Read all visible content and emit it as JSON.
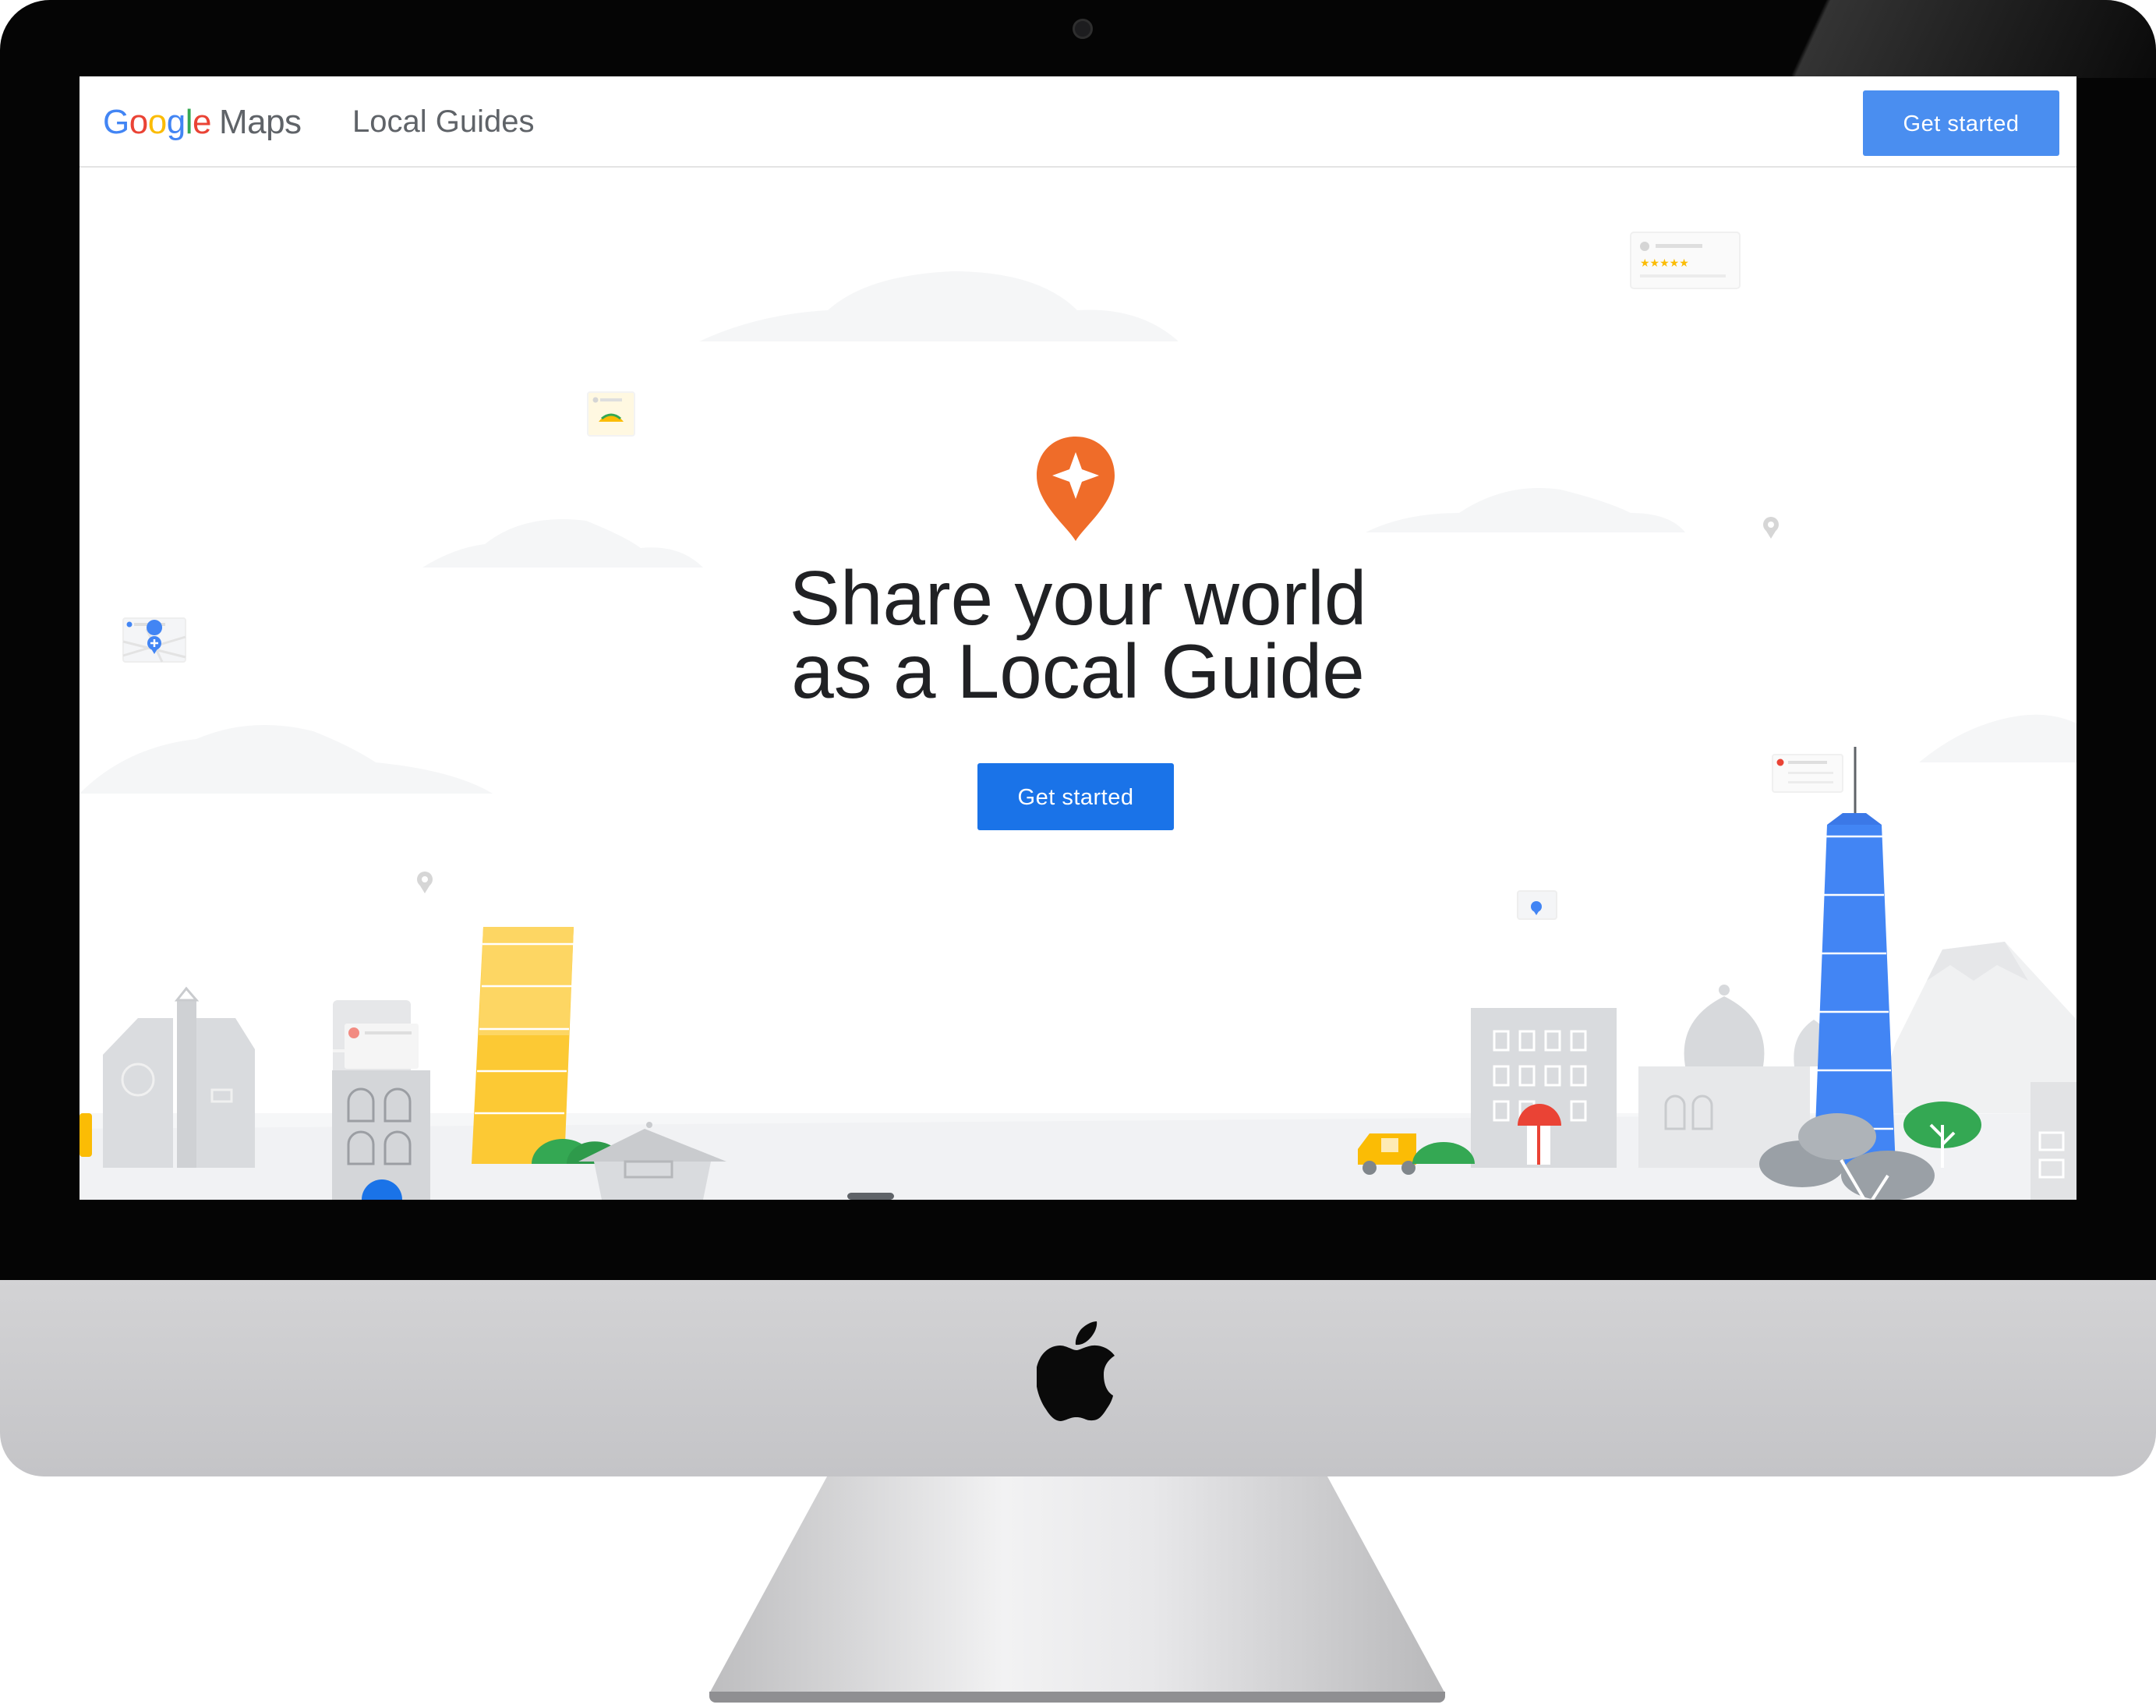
{
  "header": {
    "logo_google": "Google",
    "logo_maps": "Maps",
    "nav_title": "Local Guides",
    "cta_label": "Get started"
  },
  "hero": {
    "headline_line1": "Share your world",
    "headline_line2": "as a Local Guide",
    "cta_label": "Get started",
    "icon": "local-guides-star-pin-icon"
  },
  "colors": {
    "brand_blue": "#1a73e8",
    "header_button_blue": "#4a8ef0",
    "guide_orange": "#ef6c29",
    "text_dark": "#202124",
    "google_blue": "#4285f4",
    "google_red": "#ea4335",
    "google_yellow": "#fbbc05",
    "google_green": "#34a853"
  },
  "device": {
    "type": "iMac",
    "icon": "apple-logo-icon"
  }
}
